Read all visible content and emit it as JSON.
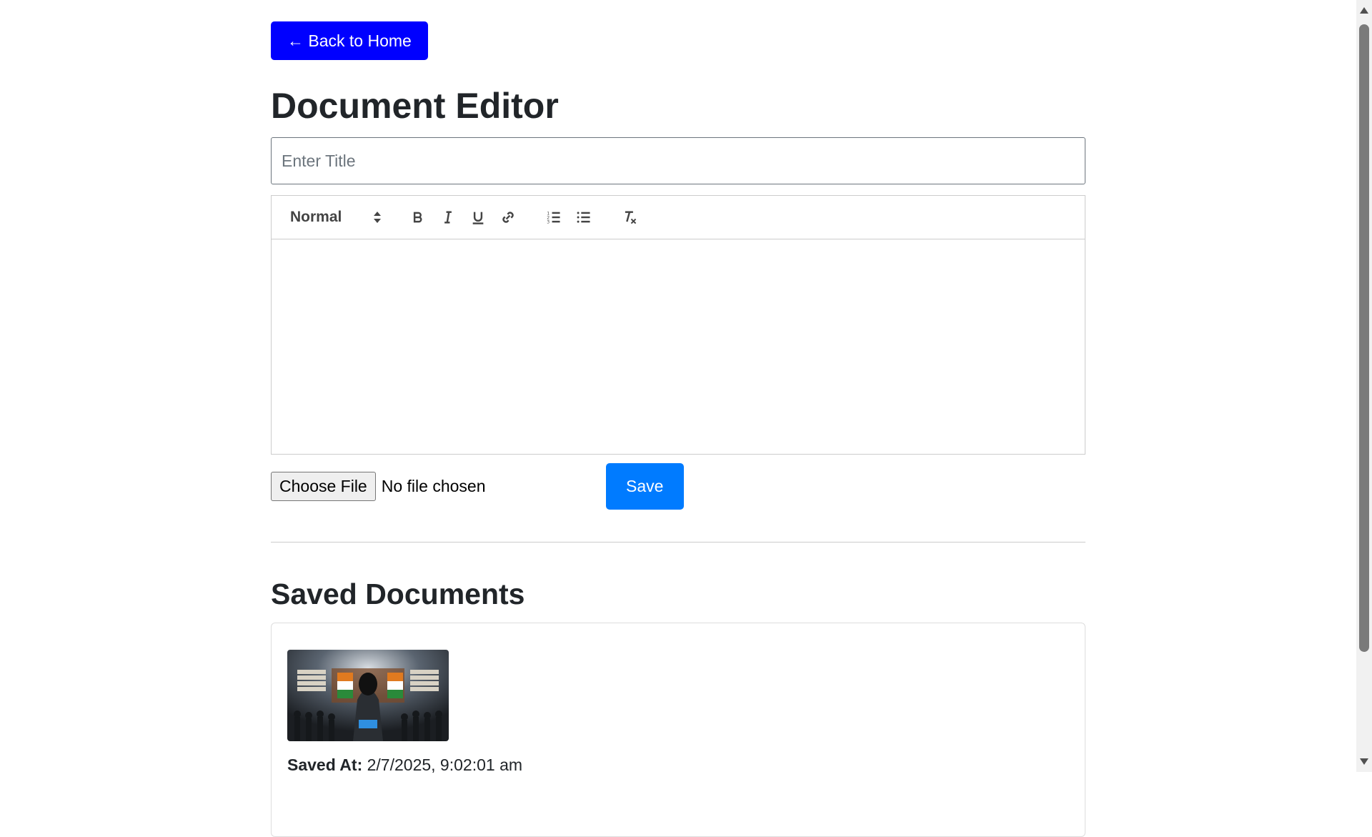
{
  "back_button": {
    "label": "← Back to Home"
  },
  "editor": {
    "heading": "Document Editor",
    "title_placeholder": "Enter Title",
    "toolbar": {
      "format_select": "Normal",
      "buttons": [
        "bold-icon",
        "italic-icon",
        "underline-icon",
        "link-icon",
        "ordered-list-icon",
        "bullet-list-icon",
        "clear-format-icon"
      ]
    },
    "content": ""
  },
  "upload": {
    "choose_file_label": "Choose File",
    "file_status": "No file chosen"
  },
  "save_button": {
    "label": "Save"
  },
  "saved_documents": {
    "heading": "Saved Documents",
    "items": [
      {
        "thumbnail": "hooded-figure-image",
        "saved_at_label": "Saved At:",
        "saved_at_value": "2/7/2025, 9:02:01 am"
      }
    ]
  },
  "colors": {
    "back_button": "#0000ff",
    "save_button": "#007bff",
    "text": "#212529"
  }
}
